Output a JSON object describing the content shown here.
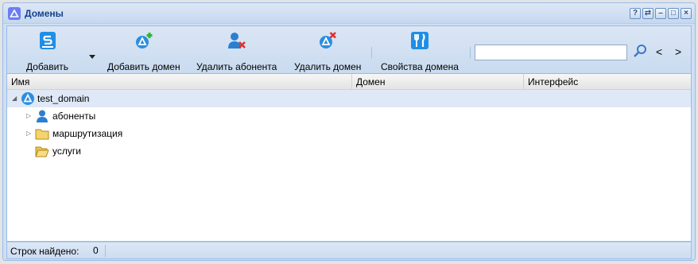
{
  "window": {
    "title": "Домены",
    "icon": "domain-triangle-icon"
  },
  "title_tools": [
    {
      "name": "help-icon",
      "glyph": "?"
    },
    {
      "name": "refresh-icon",
      "glyph": "⇄"
    },
    {
      "name": "minimize-icon",
      "glyph": "–"
    },
    {
      "name": "maximize-icon",
      "glyph": "□"
    },
    {
      "name": "close-icon",
      "glyph": "×"
    }
  ],
  "toolbar": {
    "add_label": "Добавить",
    "add_domain_label": "Добавить домен",
    "delete_subscriber_label": "Удалить абонента",
    "delete_domain_label": "Удалить домен",
    "domain_properties_label": "Свойства домена",
    "search_value": "",
    "search_icon": "search-icon",
    "prev_label": "<",
    "next_label": ">"
  },
  "grid": {
    "columns": [
      "Имя",
      "Домен",
      "Интерфейс"
    ],
    "rows": [
      {
        "label": "test_domain",
        "icon": "domain-triangle-icon",
        "expanded": true,
        "selected": true
      },
      {
        "label": "абоненты",
        "icon": "user-icon",
        "expanded": false
      },
      {
        "label": "маршрутизация",
        "icon": "folder-icon",
        "expanded": false
      },
      {
        "label": "услуги",
        "icon": "folder-open-icon",
        "expanded": null
      }
    ]
  },
  "status": {
    "label": "Строк найдено:",
    "value": "0"
  },
  "colors": {
    "accent": "#15428b",
    "selection": "#dfe8f6",
    "border": "#99bbe8"
  }
}
